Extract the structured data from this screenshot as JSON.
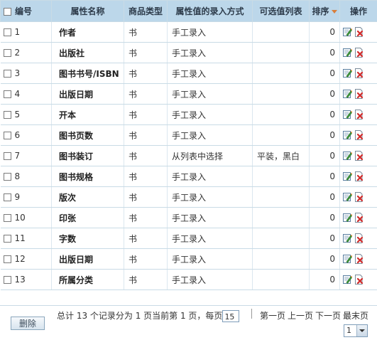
{
  "header": {
    "id": "编号",
    "name": "属性名称",
    "type": "商品类型",
    "input": "属性值的录入方式",
    "values": "可选值列表",
    "sort": "排序",
    "op": "操作"
  },
  "rows": [
    {
      "id": "1",
      "name": "作者",
      "type": "书",
      "input": "手工录入",
      "values": "",
      "sort": "0"
    },
    {
      "id": "2",
      "name": "出版社",
      "type": "书",
      "input": "手工录入",
      "values": "",
      "sort": "0"
    },
    {
      "id": "3",
      "name": "图书书号/ISBN",
      "type": "书",
      "input": "手工录入",
      "values": "",
      "sort": "0"
    },
    {
      "id": "4",
      "name": "出版日期",
      "type": "书",
      "input": "手工录入",
      "values": "",
      "sort": "0"
    },
    {
      "id": "5",
      "name": "开本",
      "type": "书",
      "input": "手工录入",
      "values": "",
      "sort": "0"
    },
    {
      "id": "6",
      "name": "图书页数",
      "type": "书",
      "input": "手工录入",
      "values": "",
      "sort": "0"
    },
    {
      "id": "7",
      "name": "图书装订",
      "type": "书",
      "input": "从列表中选择",
      "values": "平装，黑白",
      "sort": "0"
    },
    {
      "id": "8",
      "name": "图书规格",
      "type": "书",
      "input": "手工录入",
      "values": "",
      "sort": "0"
    },
    {
      "id": "9",
      "name": "版次",
      "type": "书",
      "input": "手工录入",
      "values": "",
      "sort": "0"
    },
    {
      "id": "10",
      "name": "印张",
      "type": "书",
      "input": "手工录入",
      "values": "",
      "sort": "0"
    },
    {
      "id": "11",
      "name": "字数",
      "type": "书",
      "input": "手工录入",
      "values": "",
      "sort": "0"
    },
    {
      "id": "12",
      "name": "出版日期",
      "type": "书",
      "input": "手工录入",
      "values": "",
      "sort": "0"
    },
    {
      "id": "13",
      "name": "所属分类",
      "type": "书",
      "input": "手工录入",
      "values": "",
      "sort": "0"
    }
  ],
  "icons": {
    "edit": "edit-icon",
    "delete": "delete-icon",
    "sort_arrow": "sort-desc-icon"
  },
  "colors": {
    "header_bg": "#bcd7ea",
    "border": "#c9dbe6",
    "delete_red": "#d22a2a",
    "edit_green": "#3d9a3d"
  },
  "footer": {
    "delete_button": "删除",
    "summary_prefix": "总计 13 个记录分为 1 页当前第 1 页，每页",
    "page_size": "15",
    "first": "第一页",
    "prev": "上一页",
    "next": "下一页",
    "last": "最末页",
    "page_select": "1"
  }
}
